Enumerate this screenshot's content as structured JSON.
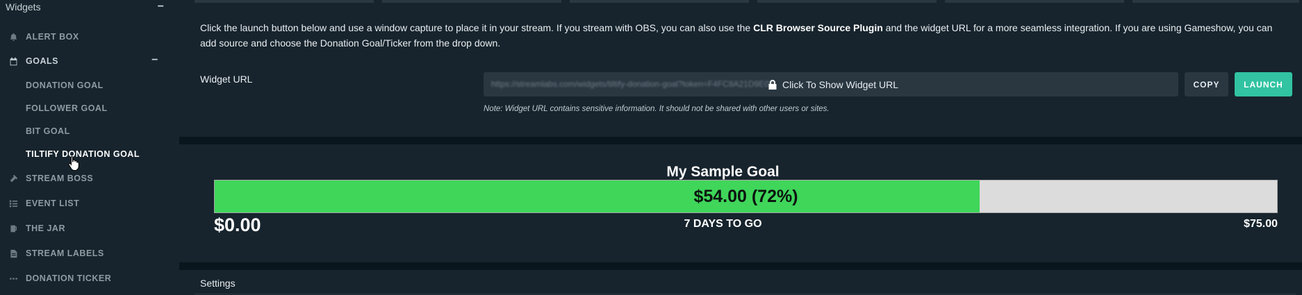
{
  "sidebar": {
    "header": "Widgets",
    "collapse_symbol": "−",
    "items": [
      {
        "label": "ALERT BOX",
        "icon": "bell-icon"
      },
      {
        "label": "GOALS",
        "icon": "calendar-icon",
        "expanded": true
      },
      {
        "label": "STREAM BOSS",
        "icon": "hammer-icon"
      },
      {
        "label": "EVENT LIST",
        "icon": "list-icon"
      },
      {
        "label": "THE JAR",
        "icon": "jar-icon"
      },
      {
        "label": "STREAM LABELS",
        "icon": "file-icon"
      },
      {
        "label": "DONATION TICKER",
        "icon": "ellipsis-icon"
      }
    ],
    "goals_subitems": [
      {
        "label": "DONATION GOAL"
      },
      {
        "label": "FOLLOWER GOAL"
      },
      {
        "label": "BIT GOAL"
      },
      {
        "label": "TILTIFY DONATION GOAL",
        "active": true
      }
    ]
  },
  "main": {
    "intro_part1": "Click the launch button below and use a window capture to place it in your stream. If you stream with OBS, you can also use the ",
    "intro_bold": "CLR Browser Source Plugin",
    "intro_part2": " and the widget URL for a more seamless integration. If you are using Gameshow, you can add source and choose the Donation Goal/Ticker from the drop down.",
    "widget_url_label": "Widget URL",
    "widget_url_blurred": "https://streamlabs.com/widgets/tiltify-donation-goal?token=F4FC8A21D9E0B",
    "widget_url_reveal": "Click To Show Widget URL",
    "copy_label": "COPY",
    "launch_label": "LAUNCH",
    "note": "Note: Widget URL contains sensitive information. It should not be shared with other users or sites.",
    "settings_label": "Settings"
  },
  "goal": {
    "title": "My Sample Goal",
    "amount_text": "$54.00 (72%)",
    "progress_fraction": 0.72,
    "start_label": "$0.00",
    "days_left": "7 DAYS TO GO",
    "end_label": "$75.00",
    "fill_color": "#3fd65a",
    "track_color": "#dcdcdc"
  },
  "colors": {
    "accent": "#31c3a2",
    "sidebar_bg": "#17242d",
    "page_bg": "#09161d"
  }
}
